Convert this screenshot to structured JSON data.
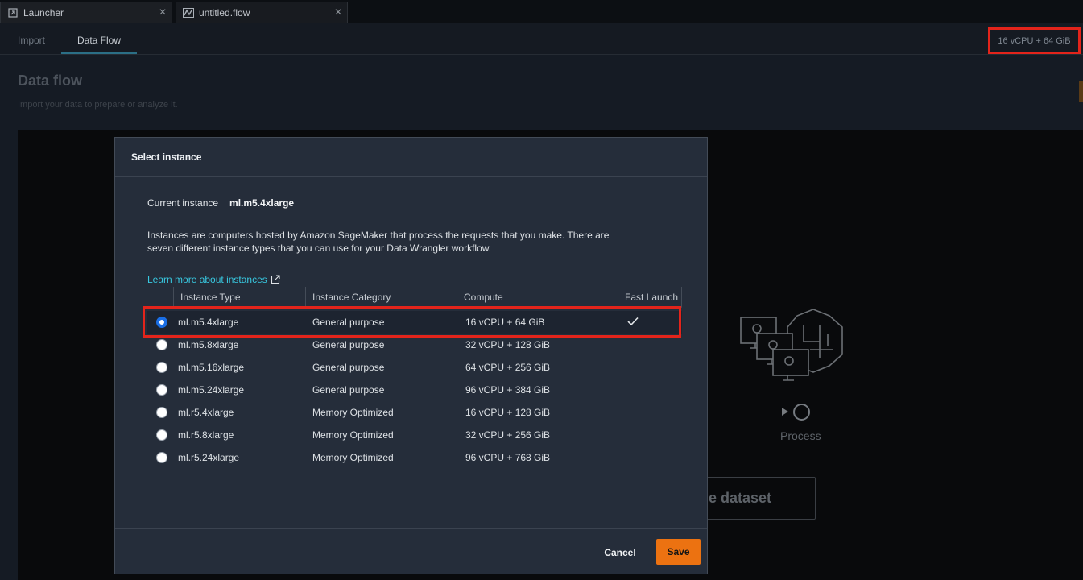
{
  "tabs": [
    {
      "label": "Launcher",
      "icon": "launcher-icon",
      "close": "×"
    },
    {
      "label": "untitled.flow",
      "icon": "flow-icon",
      "close": "×"
    }
  ],
  "subtabs": [
    "Import",
    "Data Flow"
  ],
  "instance_chip": "16 vCPU + 64 GiB",
  "page": {
    "title": "Data flow",
    "subtitle": "Import your data to prepare or analyze it."
  },
  "background": {
    "process_label": "Process",
    "button_partial": "le dataset"
  },
  "modal": {
    "title": "Select instance",
    "current_label": "Current instance",
    "current_value": "ml.m5.4xlarge",
    "description": "Instances are computers hosted by Amazon SageMaker that process the requests that you make. There are seven different instance types that you can use for your Data Wrangler workflow.",
    "learn_more": "Learn more about instances",
    "columns": [
      "Instance Type",
      "Instance Category",
      "Compute",
      "Fast Launch"
    ],
    "rows": [
      {
        "type": "ml.m5.4xlarge",
        "category": "General purpose",
        "compute": "16 vCPU + 64 GiB",
        "fast": "✓",
        "selected": true
      },
      {
        "type": "ml.m5.8xlarge",
        "category": "General purpose",
        "compute": "32 vCPU + 128 GiB",
        "fast": "",
        "selected": false
      },
      {
        "type": "ml.m5.16xlarge",
        "category": "General purpose",
        "compute": "64 vCPU + 256 GiB",
        "fast": "",
        "selected": false
      },
      {
        "type": "ml.m5.24xlarge",
        "category": "General purpose",
        "compute": "96 vCPU + 384 GiB",
        "fast": "",
        "selected": false
      },
      {
        "type": "ml.r5.4xlarge",
        "category": "Memory Optimized",
        "compute": "16 vCPU + 128 GiB",
        "fast": "",
        "selected": false
      },
      {
        "type": "ml.r5.8xlarge",
        "category": "Memory Optimized",
        "compute": "32 vCPU + 256 GiB",
        "fast": "",
        "selected": false
      },
      {
        "type": "ml.r5.24xlarge",
        "category": "Memory Optimized",
        "compute": "96 vCPU + 768 GiB",
        "fast": "",
        "selected": false
      }
    ],
    "cancel_label": "Cancel",
    "save_label": "Save"
  },
  "colors": {
    "accent": "#ec7211",
    "link": "#38c8e0",
    "highlight": "#e3241b",
    "radio_selected": "#1a6ee5"
  }
}
